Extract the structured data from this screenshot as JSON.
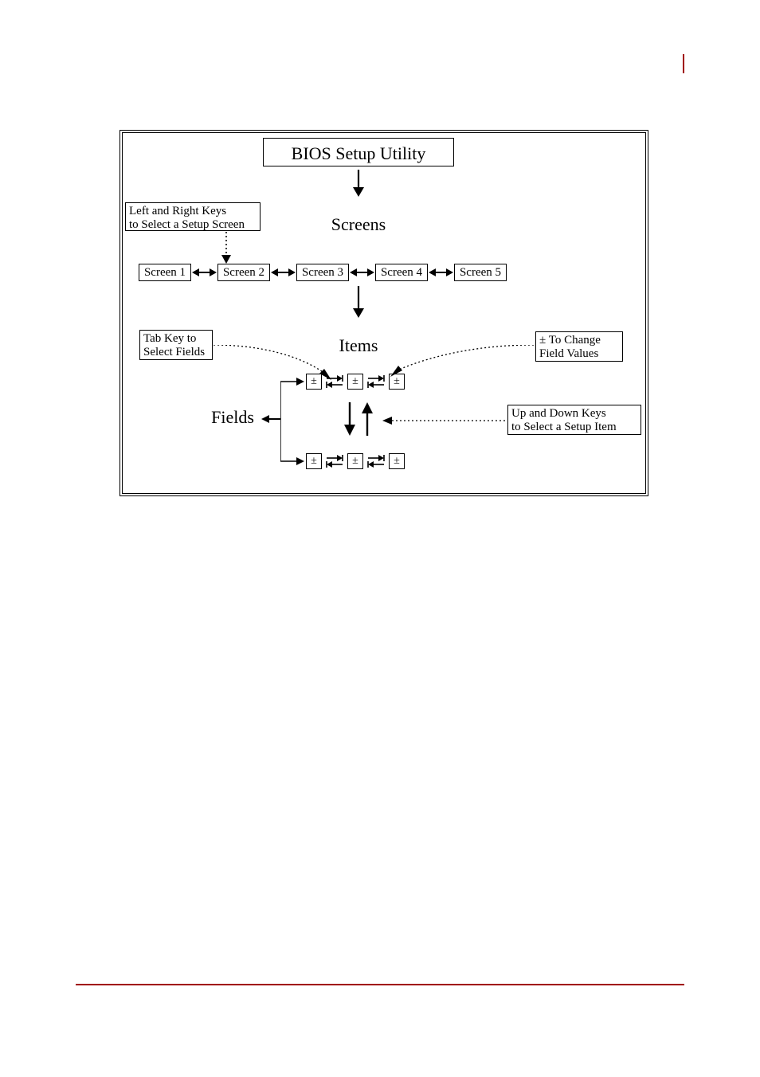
{
  "title": "BIOS Setup Utility",
  "labels": {
    "screens": "Screens",
    "items": "Items",
    "fields": "Fields"
  },
  "notes": {
    "left_right": "Left and Right Keys\nto Select a Setup Screen",
    "tab": "Tab Key to\nSelect Fields",
    "plus_minus": "± To Change\nField Values",
    "up_down": "Up and Down Keys\nto Select a Setup Item"
  },
  "screens": [
    "Screen 1",
    "Screen 2",
    "Screen 3",
    "Screen 4",
    "Screen 5"
  ],
  "pm_symbol": "±"
}
